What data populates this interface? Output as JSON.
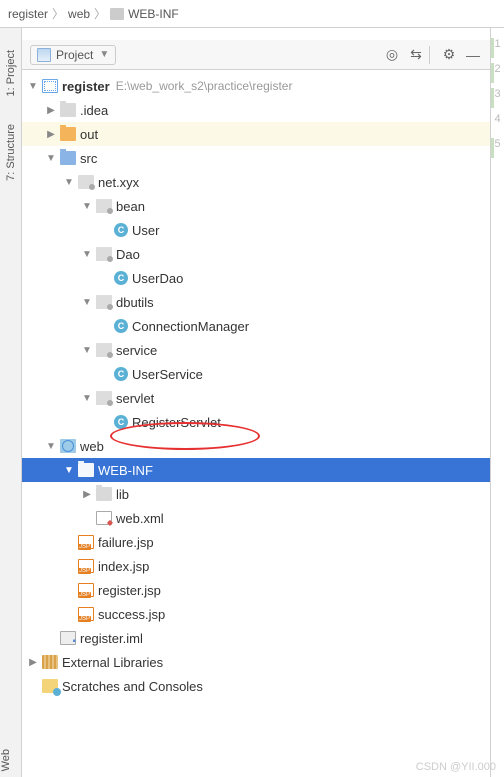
{
  "breadcrumb": {
    "item1": "register",
    "item2": "web",
    "item3": "WEB-INF"
  },
  "sidebar": {
    "tab_project": "1: Project",
    "tab_structure": "7: Structure",
    "tab_web": "Web"
  },
  "panel": {
    "title": "Project",
    "collapse_tooltip": "Collapse",
    "settings_tooltip": "Settings",
    "hide_tooltip": "Hide"
  },
  "tree": {
    "root": {
      "name": "register",
      "path": "E:\\web_work_s2\\practice\\register"
    },
    "idea": ".idea",
    "out": "out",
    "src": "src",
    "pkg": "net.xyx",
    "bean": "bean",
    "user": "User",
    "dao_pkg": "Dao",
    "userdao": "UserDao",
    "dbutils": "dbutils",
    "connmgr": "ConnectionManager",
    "service": "service",
    "userservice": "UserService",
    "servlet": "servlet",
    "regservlet": "RegisterServlet",
    "web": "web",
    "webinf": "WEB-INF",
    "lib": "lib",
    "webxml": "web.xml",
    "failure": "failure.jsp",
    "index": "index.jsp",
    "register_jsp": "register.jsp",
    "success": "success.jsp",
    "iml": "register.iml",
    "ext": "External Libraries",
    "scratch": "Scratches and Consoles"
  },
  "gutter": [
    "1",
    "2",
    "3",
    "4",
    "5"
  ],
  "gutter_colors": [
    "#c8e0c1",
    "#c8e0c1",
    "#c8e0c1",
    "",
    "#c8e0c1"
  ],
  "watermark": "CSDN @YII.000"
}
